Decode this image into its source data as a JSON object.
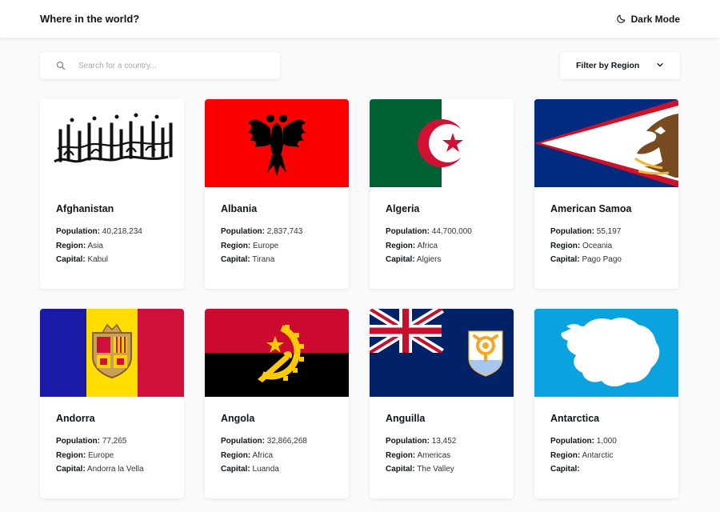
{
  "header": {
    "title": "Where in the world?",
    "dark_mode_label": "Dark Mode"
  },
  "search": {
    "placeholder": "Search for a country...",
    "value": ""
  },
  "filter": {
    "label": "Filter by Region"
  },
  "labels": {
    "population": "Population:",
    "region": "Region:",
    "capital": "Capital:"
  },
  "countries": [
    {
      "name": "Afghanistan",
      "population": "40,218,234",
      "region": "Asia",
      "capital": "Kabul",
      "flag": "afghanistan-flag"
    },
    {
      "name": "Albania",
      "population": "2,837,743",
      "region": "Europe",
      "capital": "Tirana",
      "flag": "albania-flag"
    },
    {
      "name": "Algeria",
      "population": "44,700,000",
      "region": "Africa",
      "capital": "Algiers",
      "flag": "algeria-flag"
    },
    {
      "name": "American Samoa",
      "population": "55,197",
      "region": "Oceania",
      "capital": "Pago Pago",
      "flag": "american-samoa-flag"
    },
    {
      "name": "Andorra",
      "population": "77,265",
      "region": "Europe",
      "capital": "Andorra la Vella",
      "flag": "andorra-flag"
    },
    {
      "name": "Angola",
      "population": "32,866,268",
      "region": "Africa",
      "capital": "Luanda",
      "flag": "angola-flag"
    },
    {
      "name": "Anguilla",
      "population": "13,452",
      "region": "Americas",
      "capital": "The Valley",
      "flag": "anguilla-flag"
    },
    {
      "name": "Antarctica",
      "population": "1,000",
      "region": "Antarctic",
      "capital": "",
      "flag": "antarctica-flag"
    }
  ],
  "colors": {
    "background": "#fafafa",
    "card": "#ffffff",
    "text": "#111517",
    "placeholder": "#a7a7a7"
  }
}
